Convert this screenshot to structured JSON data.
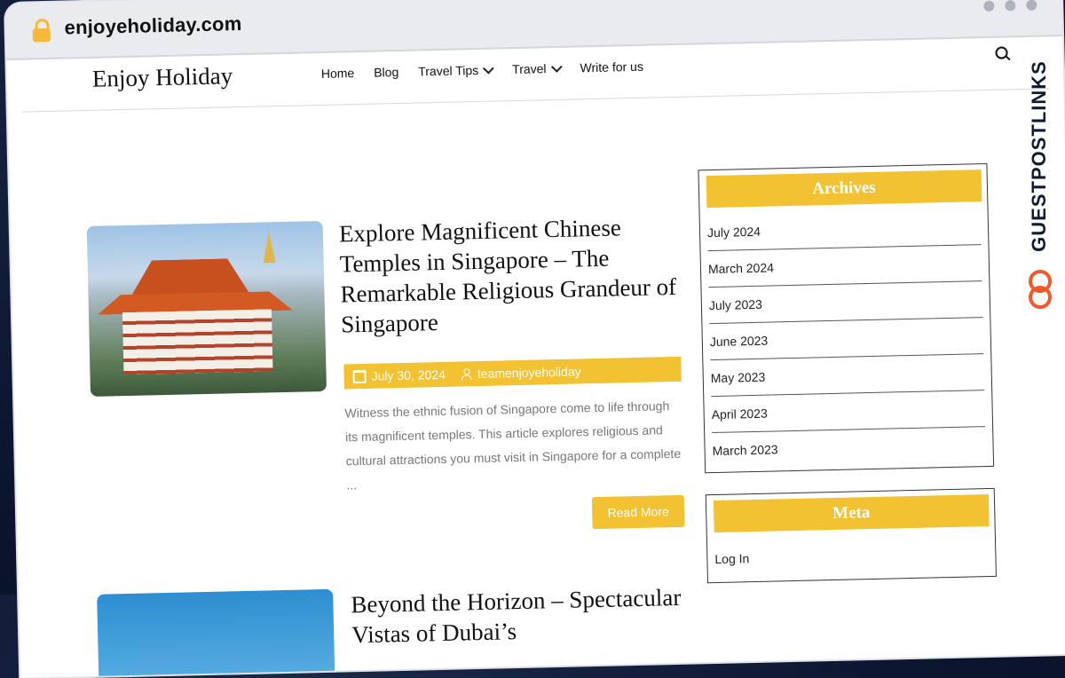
{
  "browser": {
    "url": "enjoyeholiday.com"
  },
  "site": {
    "logo": "Enjoy Holiday",
    "nav": [
      "Home",
      "Blog",
      "Travel Tips",
      "Travel",
      "Write for us"
    ]
  },
  "post1": {
    "title": "Explore Magnificent Chinese Temples in Singapore – The Remarkable Religious Grandeur of Singapore",
    "date": "July 30, 2024",
    "author": "teamenjoyeholiday",
    "excerpt": "Witness the ethnic fusion of Singapore come to life through its magnificent temples. This article explores religious and cultural attractions you must visit in Singapore for a complete ...",
    "read_more": "Read More"
  },
  "post2": {
    "title": "Beyond the Horizon – Spectacular Vistas of Dubai’s"
  },
  "sidebar": {
    "archives_title": "Archives",
    "archives": [
      "July 2024",
      "March 2024",
      "July 2023",
      "June 2023",
      "May 2023",
      "April 2023",
      "March 2023"
    ],
    "meta_title": "Meta",
    "meta_items": [
      "Log In"
    ]
  },
  "watermark": {
    "text": "GUESTPOSTLINKS"
  },
  "colors": {
    "accent": "#f2c232",
    "watermark_icon": "#f05a2a"
  }
}
